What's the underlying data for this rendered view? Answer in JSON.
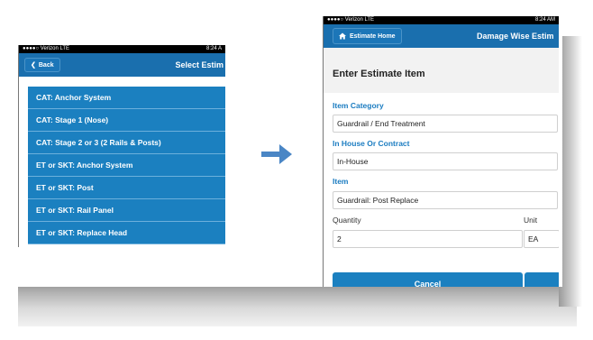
{
  "left_phone": {
    "status": {
      "carrier": "●●●●○ Verizon  LTE",
      "time": "8:24 A"
    },
    "nav": {
      "back_label": "Back",
      "title": "Select Estim"
    },
    "items": [
      "CAT: Anchor System",
      "CAT: Stage 1 (Nose)",
      "CAT: Stage 2 or 3 (2 Rails & Posts)",
      "ET or SKT: Anchor System",
      "ET or SKT: Post",
      "ET or SKT: Rail Panel",
      "ET or SKT: Replace Head"
    ]
  },
  "right_phone": {
    "status": {
      "carrier": "●●●●○ Verizon  LTE",
      "time": "8:24 AM"
    },
    "nav": {
      "home_label": "Estimate Home",
      "title": "Damage Wise Estim"
    },
    "form": {
      "title": "Enter Estimate Item",
      "item_category_label": "Item Category",
      "item_category_value": "Guardrail / End Treatment",
      "inhouse_label": "In House Or Contract",
      "inhouse_value": "In-House",
      "item_label": "Item",
      "item_value": "Guardrail: Post Replace",
      "quantity_label": "Quantity",
      "quantity_value": "2",
      "unit_label": "Unit",
      "unit_value": "EA",
      "cancel_label": "Cancel"
    }
  },
  "colors": {
    "accent": "#1b80c0",
    "nav": "#1a6fae",
    "label_blue": "#1b7cc1",
    "arrow": "#4a86c5"
  }
}
